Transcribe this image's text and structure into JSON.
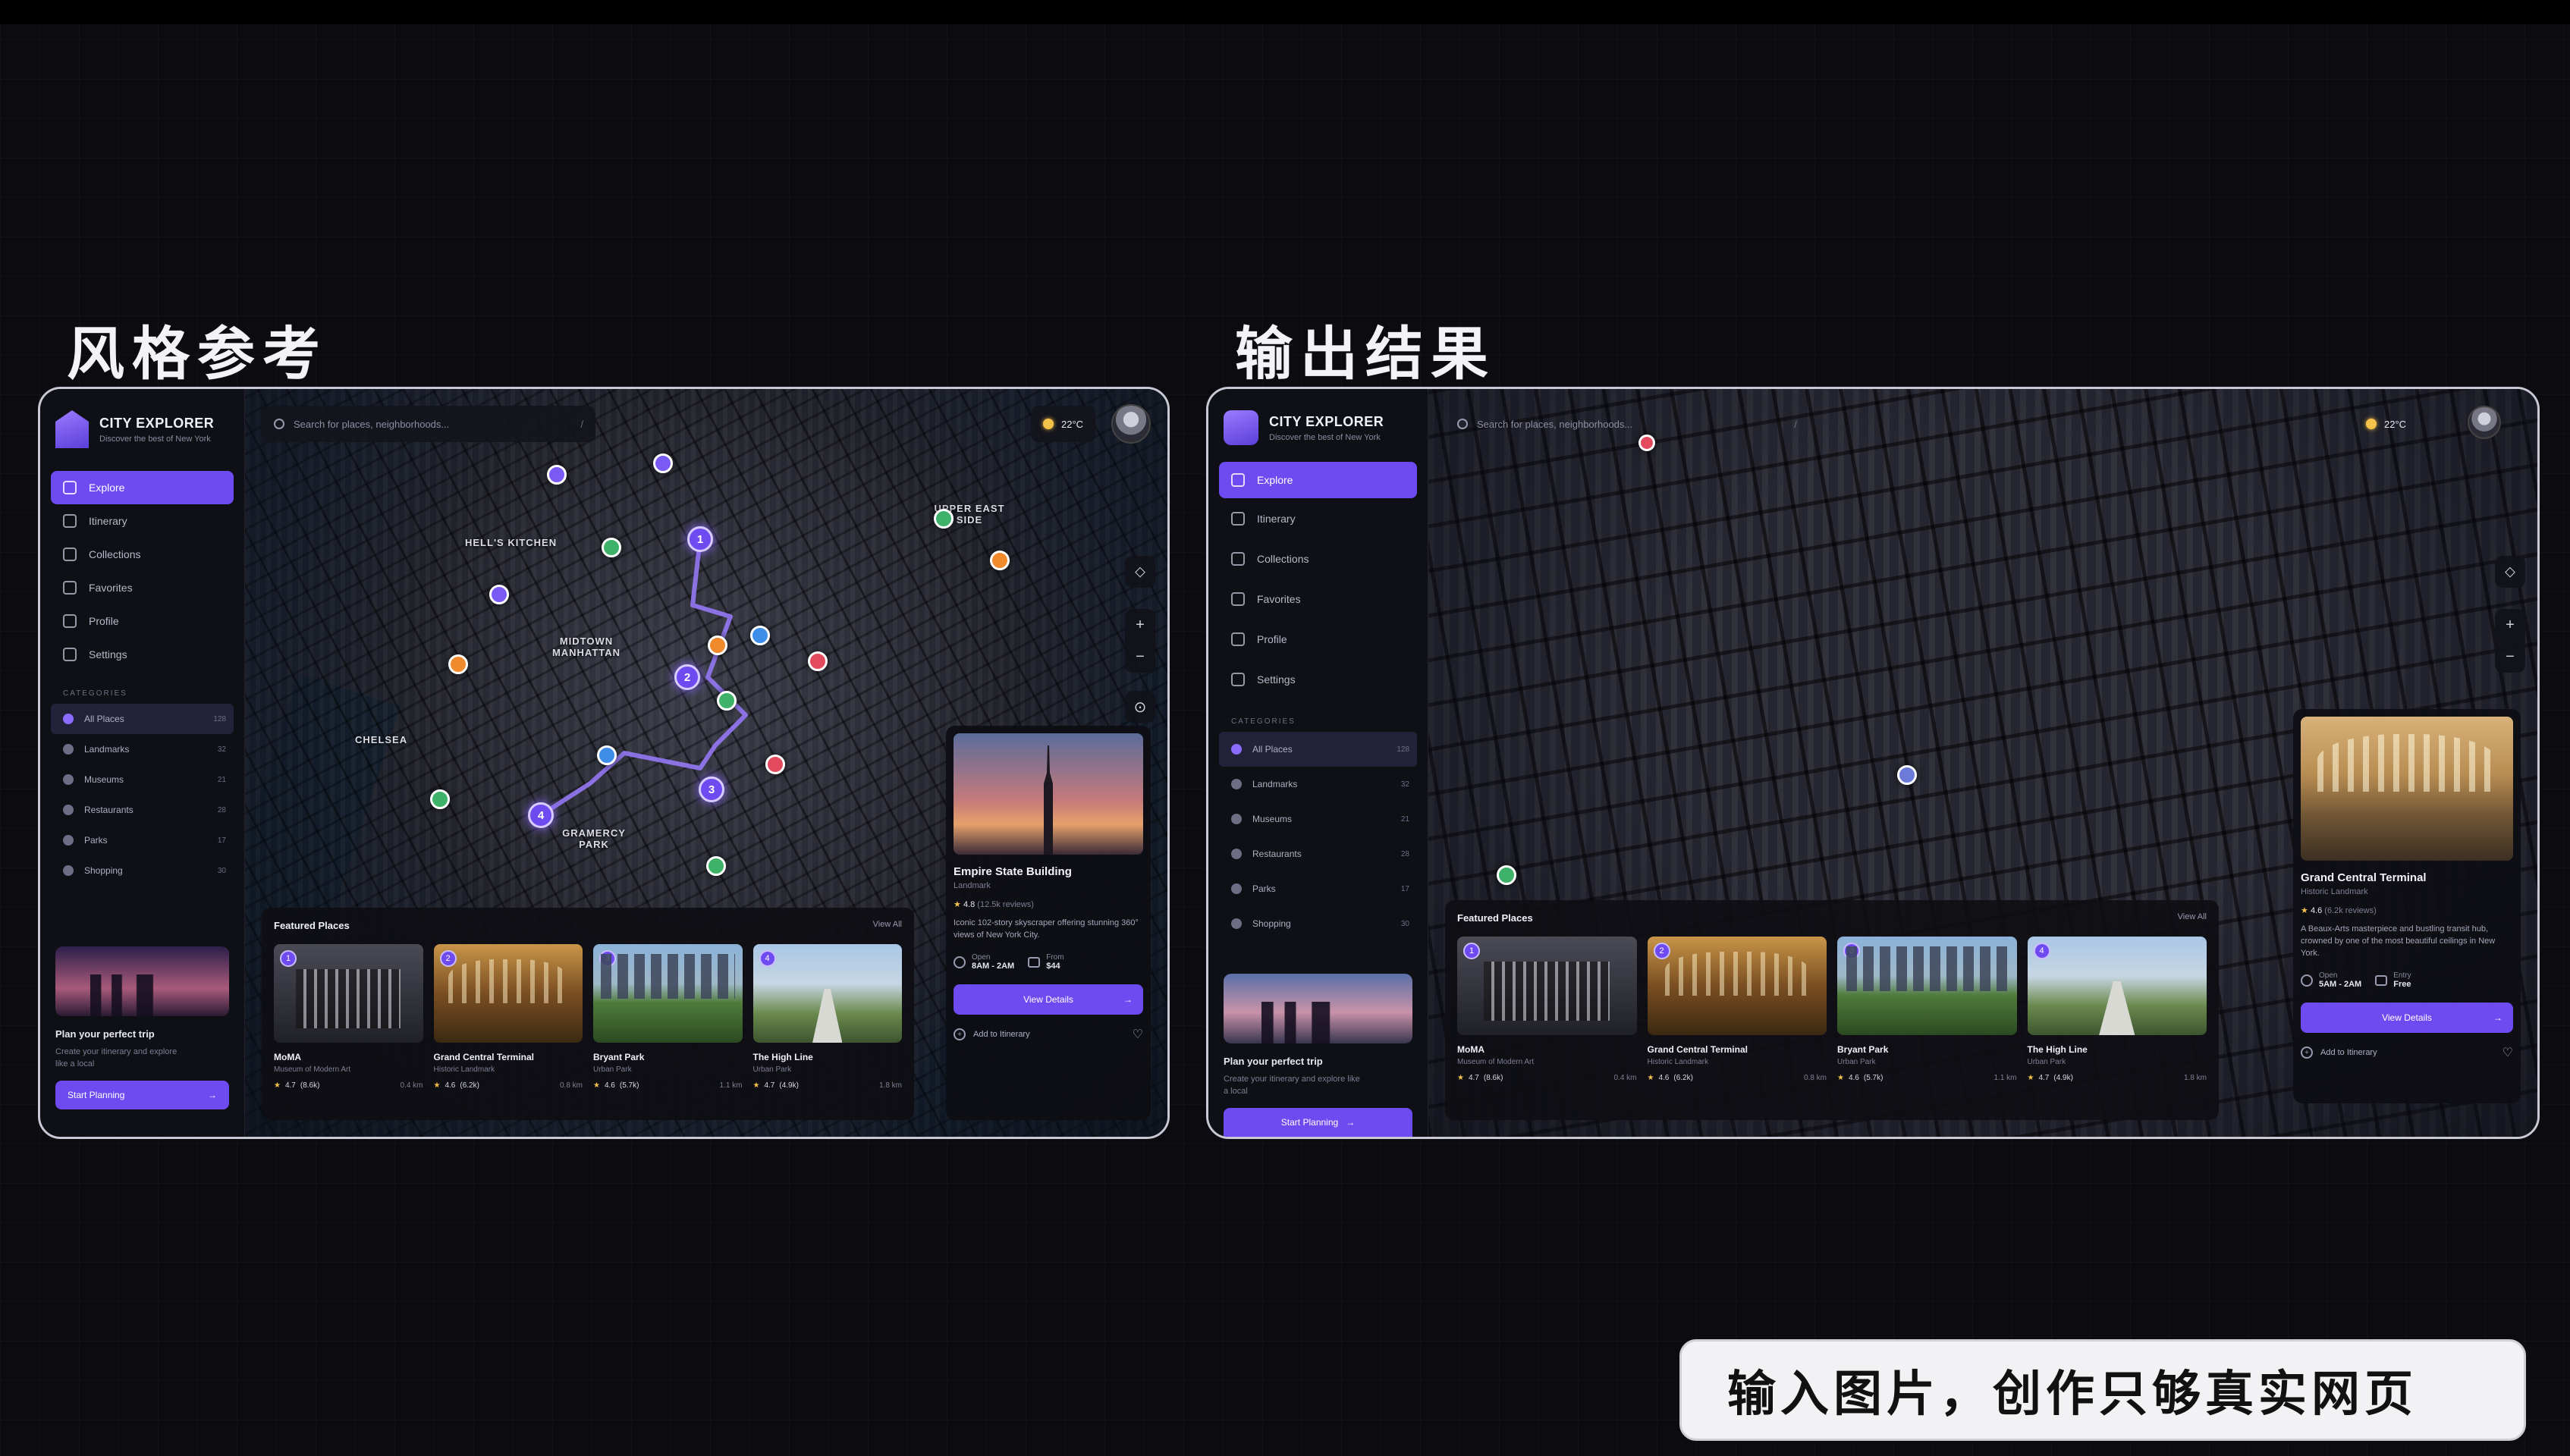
{
  "headings": {
    "left": "风格参考",
    "right": "输出结果"
  },
  "caption": "输入图片，创作只够真实网页",
  "colors": {
    "accent": "#6d4bf0",
    "background": "#0b0b10",
    "star": "#f5c24a"
  },
  "left": {
    "brand": {
      "title": "CITY EXPLORER",
      "subtitle": "Discover the best of New York"
    },
    "nav": [
      "Explore",
      "Itinerary",
      "Collections",
      "Favorites",
      "Profile",
      "Settings"
    ],
    "categories_heading": "CATEGORIES",
    "categories": [
      {
        "label": "All Places",
        "count": "128"
      },
      {
        "label": "Landmarks",
        "count": "32"
      },
      {
        "label": "Museums",
        "count": "21"
      },
      {
        "label": "Restaurants",
        "count": "28"
      },
      {
        "label": "Parks",
        "count": "17"
      },
      {
        "label": "Shopping",
        "count": "30"
      }
    ],
    "promo": {
      "title": "Plan your perfect trip",
      "text": "Create your itinerary and explore like a local",
      "button": "Start Planning"
    },
    "search_placeholder": "Search for places, neighborhoods...",
    "search_shortcut": "/",
    "weather": "22°C",
    "map_labels": [
      "HELL'S KITCHEN",
      "MIDTOWN MANHATTAN",
      "CHELSEA",
      "GRAMERCY PARK",
      "UPPER EAST SIDE"
    ],
    "route_stops": [
      "1",
      "2",
      "3",
      "4"
    ],
    "featured": {
      "title": "Featured Places",
      "view_all": "View All",
      "cards": [
        {
          "num": "1",
          "name": "MoMA",
          "sub": "Museum of Modern Art",
          "rating": "4.7",
          "reviews": "(8.6k)",
          "dist": "0.4 km"
        },
        {
          "num": "2",
          "name": "Grand Central Terminal",
          "sub": "Historic Landmark",
          "rating": "4.6",
          "reviews": "(6.2k)",
          "dist": "0.8 km"
        },
        {
          "num": "3",
          "name": "Bryant Park",
          "sub": "Urban Park",
          "rating": "4.6",
          "reviews": "(5.7k)",
          "dist": "1.1 km"
        },
        {
          "num": "4",
          "name": "The High Line",
          "sub": "Urban Park",
          "rating": "4.7",
          "reviews": "(4.9k)",
          "dist": "1.8 km"
        }
      ]
    },
    "detail": {
      "title": "Empire State Building",
      "category": "Landmark",
      "rating": "4.8",
      "reviews": "(12.5k reviews)",
      "desc": "Iconic 102-story skyscraper offering stunning 360° views of New York City.",
      "open_label": "Open",
      "open_value": "8AM - 2AM",
      "price_label": "From",
      "price_value": "$44",
      "button": "View Details",
      "add": "Add to Itinerary"
    }
  },
  "right": {
    "brand": {
      "title": "CITY EXPLORER",
      "subtitle": "Discover the best of New York"
    },
    "nav": [
      "Explore",
      "Itinerary",
      "Collections",
      "Favorites",
      "Profile",
      "Settings"
    ],
    "categories_heading": "CATEGORIES",
    "categories": [
      {
        "label": "All Places",
        "count": "128"
      },
      {
        "label": "Landmarks",
        "count": "32"
      },
      {
        "label": "Museums",
        "count": "21"
      },
      {
        "label": "Restaurants",
        "count": "28"
      },
      {
        "label": "Parks",
        "count": "17"
      },
      {
        "label": "Shopping",
        "count": "30"
      }
    ],
    "promo": {
      "title": "Plan your perfect trip",
      "text": "Create your itinerary and explore like a local",
      "button": "Start Planning"
    },
    "search_placeholder": "Search for places, neighborhoods...",
    "search_shortcut": "/",
    "weather": "22°C",
    "featured": {
      "title": "Featured Places",
      "view_all": "View All",
      "cards": [
        {
          "num": "1",
          "name": "MoMA",
          "sub": "Museum of Modern Art",
          "rating": "4.7",
          "reviews": "(8.6k)",
          "dist": "0.4 km"
        },
        {
          "num": "2",
          "name": "Grand Central Terminal",
          "sub": "Historic Landmark",
          "rating": "4.6",
          "reviews": "(6.2k)",
          "dist": "0.8 km"
        },
        {
          "num": "3",
          "name": "Bryant Park",
          "sub": "Urban Park",
          "rating": "4.6",
          "reviews": "(5.7k)",
          "dist": "1.1 km"
        },
        {
          "num": "4",
          "name": "The High Line",
          "sub": "Urban Park",
          "rating": "4.7",
          "reviews": "(4.9k)",
          "dist": "1.8 km"
        }
      ]
    },
    "detail": {
      "title": "Grand Central Terminal",
      "category": "Historic Landmark",
      "rating": "4.6",
      "reviews": "(6.2k reviews)",
      "desc": "A Beaux-Arts masterpiece and bustling transit hub, crowned by one of the most beautiful ceilings in New York.",
      "open_label": "Open",
      "open_value": "5AM - 2AM",
      "price_label": "Entry",
      "price_value": "Free",
      "button": "View Details",
      "add": "Add to Itinerary"
    }
  }
}
